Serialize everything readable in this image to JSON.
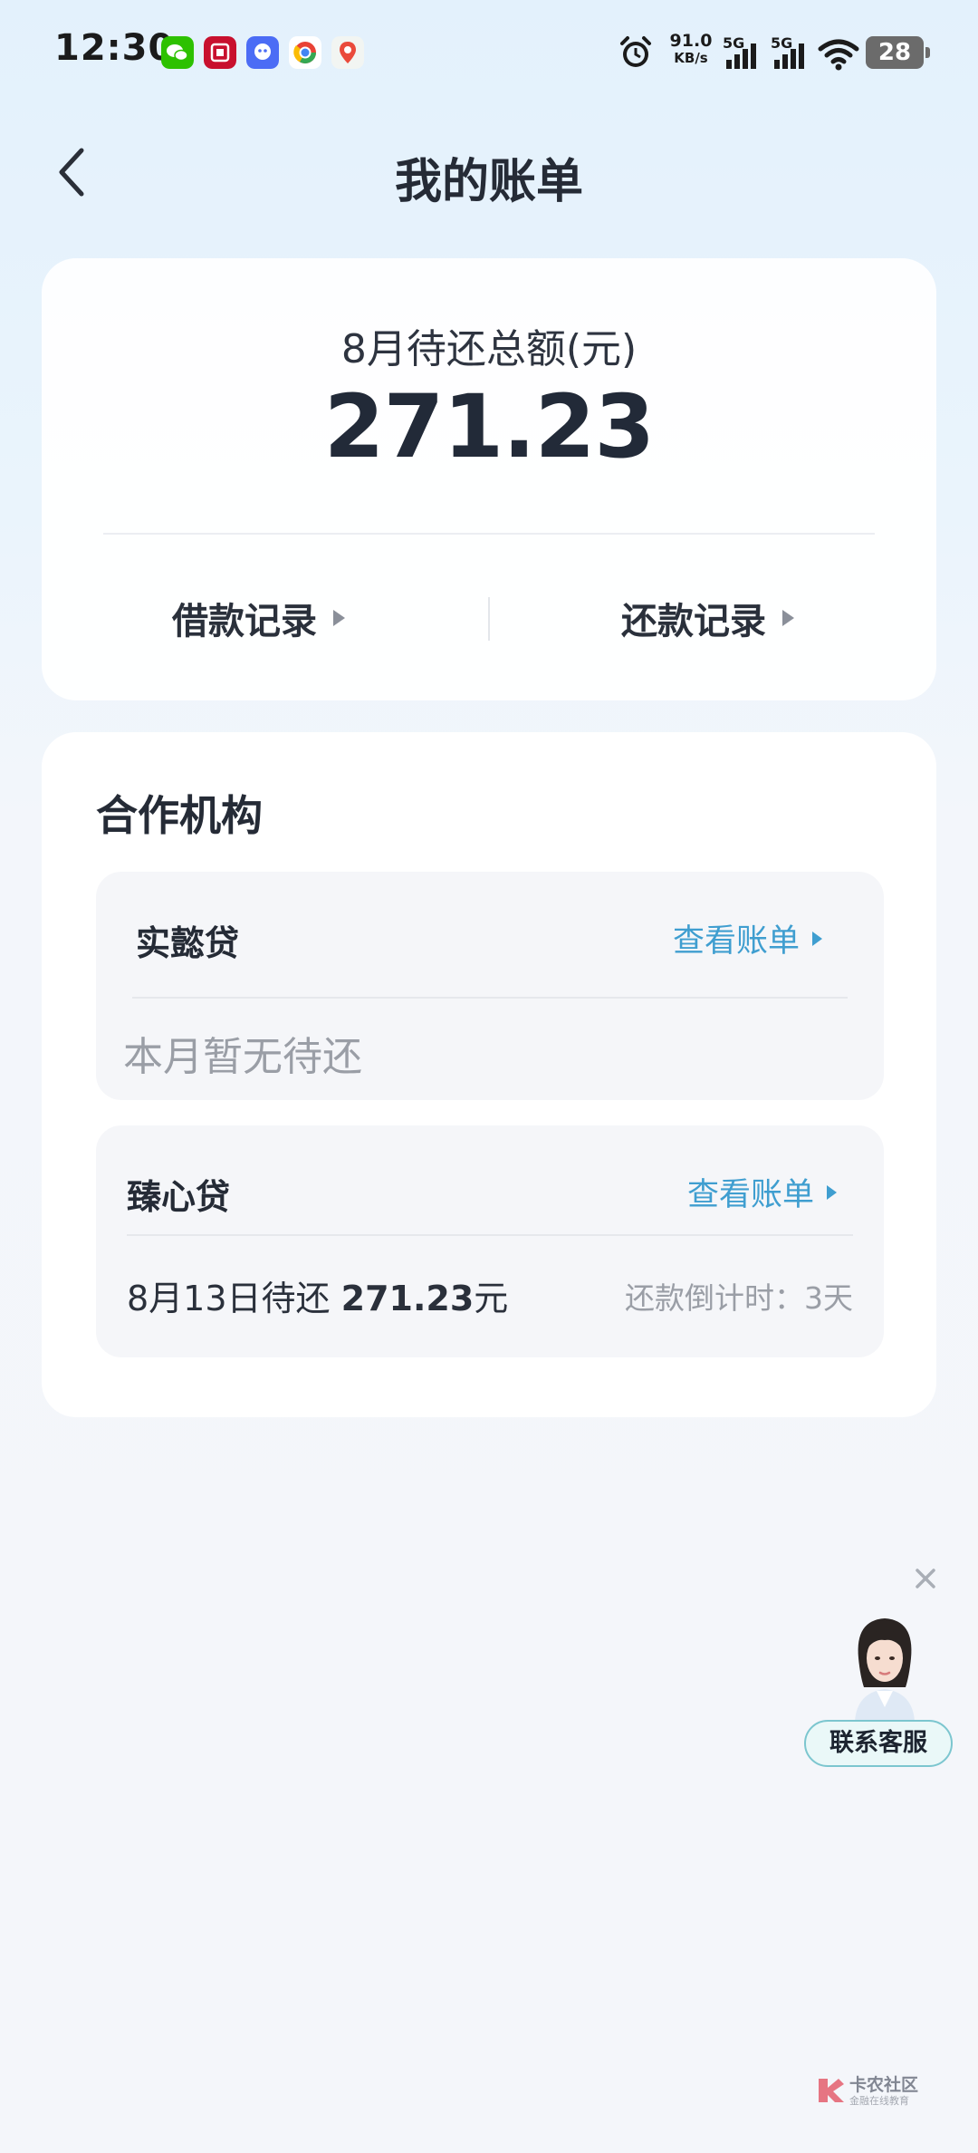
{
  "status_bar": {
    "time": "12:30",
    "net_speed_value": "91.0",
    "net_speed_unit": "KB/s",
    "signal_1_label": "5G",
    "signal_2_label": "5G",
    "battery": "28",
    "icons": [
      "wechat-icon",
      "bank-app-icon",
      "qq-icon",
      "chrome-style-icon",
      "maps-icon",
      "alarm-icon",
      "signal-icon",
      "wifi-icon",
      "battery-icon"
    ]
  },
  "header": {
    "title": "我的账单"
  },
  "summary": {
    "label": "8月待还总额(元)",
    "amount": "271.23",
    "borrow_records": "借款记录",
    "repay_records": "还款记录"
  },
  "partners": {
    "title": "合作机构",
    "lenders": [
      {
        "name": "实懿贷",
        "view_bill": "查看账单",
        "note": "本月暂无待还"
      },
      {
        "name": "臻心贷",
        "view_bill": "查看账单",
        "due_prefix": "8月13日待还 ",
        "due_amount": "271.23",
        "due_unit": "元",
        "countdown": "还款倒计时：3天"
      }
    ]
  },
  "floating": {
    "service_label": "联系客服"
  },
  "watermark": {
    "text": "卡农社区",
    "sub": "金融在线教育"
  },
  "colors": {
    "accent": "#3f9ed0",
    "title": "#252b36",
    "muted": "#9a9ea6",
    "card_bg": "#ffffff",
    "inner_bg": "#f5f6f9"
  }
}
